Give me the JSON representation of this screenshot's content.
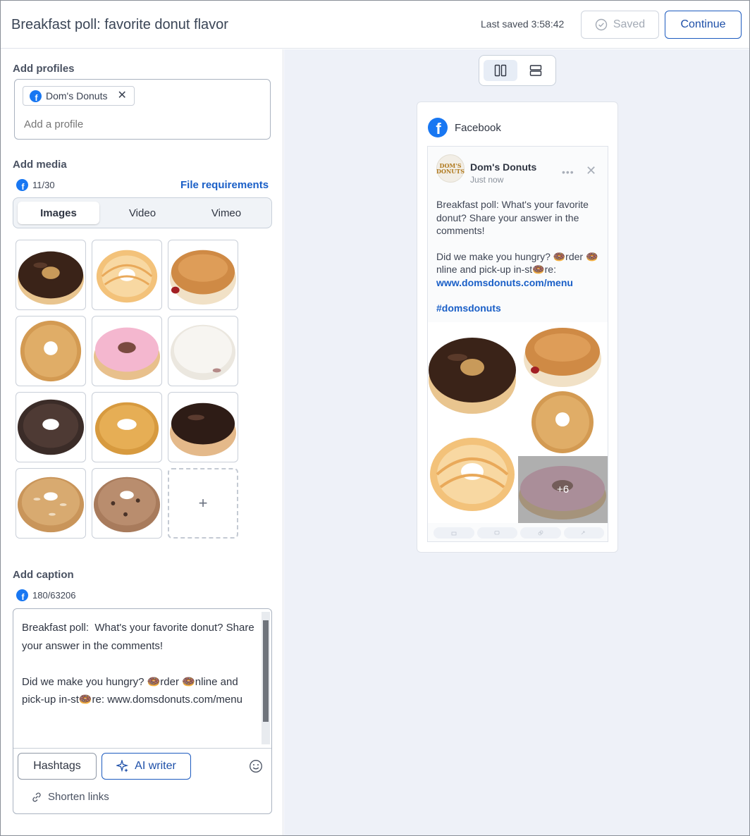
{
  "header": {
    "title": "Breakfast poll: favorite donut flavor",
    "last_saved": "Last saved 3:58:42",
    "saved_label": "Saved",
    "continue_label": "Continue"
  },
  "profiles": {
    "section_label": "Add profiles",
    "chips": [
      {
        "name": "Dom's Donuts",
        "network": "facebook"
      }
    ],
    "placeholder": "Add a profile"
  },
  "media": {
    "section_label": "Add media",
    "count": "11/30",
    "file_requirements": "File requirements",
    "tabs": [
      {
        "label": "Images",
        "active": true
      },
      {
        "label": "Video",
        "active": false
      },
      {
        "label": "Vimeo",
        "active": false
      }
    ],
    "images": [
      {
        "name": "chocolate-glazed"
      },
      {
        "name": "french-cruller"
      },
      {
        "name": "jelly-filled"
      },
      {
        "name": "sugar-old-fashioned"
      },
      {
        "name": "strawberry-frosted"
      },
      {
        "name": "powdered-filled"
      },
      {
        "name": "chocolate-cake"
      },
      {
        "name": "coconut-crunch"
      },
      {
        "name": "chocolate-filled"
      },
      {
        "name": "almond-glazed"
      },
      {
        "name": "chocolate-chip"
      }
    ],
    "add_icon": "plus-icon"
  },
  "caption": {
    "section_label": "Add caption",
    "count": "180/63206",
    "text": "Breakfast poll:  What's your favorite donut? Share your answer in the comments!\n\nDid we make you hungry? 🍩rder 🍩nline and pick-up in-st🍩re: www.domsdonuts.com/menu",
    "hashtags_label": "Hashtags",
    "ai_writer_label": "AI writer",
    "shorten_links_label": "Shorten links"
  },
  "preview": {
    "network": "Facebook",
    "page_name": "Dom's Donuts",
    "avatar_text": "DOM'S DONUTS",
    "time": "Just now",
    "text_p1": "Breakfast poll:  What's your favorite donut? Share your answer in the comments!",
    "text_p2": "Did we make you hungry? 🍩rder 🍩nline and pick-up in-st🍩re:",
    "link": "www.domsdonuts.com/menu",
    "hashtag": "#domsdonuts",
    "more_count": "+6"
  },
  "colors": {
    "accent": "#1d5bbf",
    "facebook": "#1877f2",
    "link": "#1a5fc7",
    "panel_bg": "#eef1f8"
  }
}
